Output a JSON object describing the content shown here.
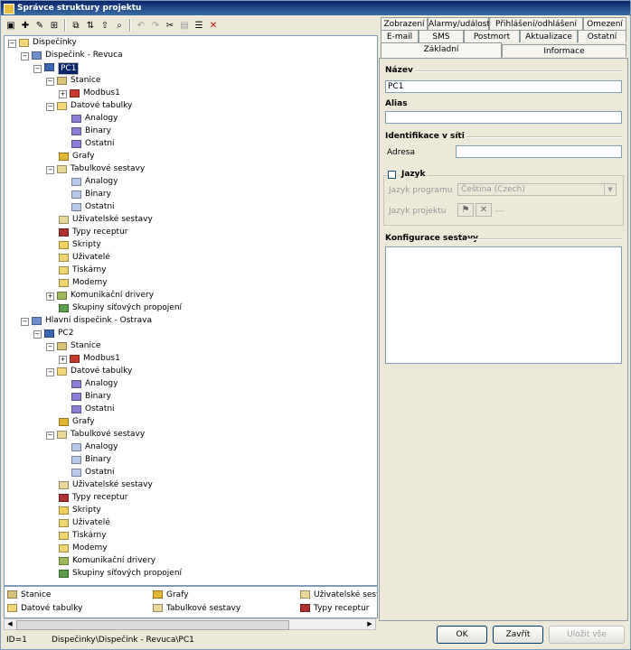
{
  "window": {
    "title": "Správce struktury projektu"
  },
  "tree": {
    "root": "Dispečinky",
    "dispatch1": "Dispečink - Revuca",
    "pc1": "PC1",
    "stanice": "Stanice",
    "modbus": "Modbus1",
    "datove_tabulky": "Datové tabulky",
    "analogy": "Analogy",
    "binary": "Binary",
    "ostatni": "Ostatni",
    "grafy": "Grafy",
    "tabulkove_sestavy": "Tabulkové sestavy",
    "uzivatelske_sestavy": "Uživatelské sestavy",
    "typy_receptur": "Typy receptur",
    "skripty": "Skripty",
    "uzivatele": "Uživatelé",
    "tiskarny": "Tiskárny",
    "modemy": "Modemy",
    "komunikacni_drivery": "Komunikační drivery",
    "skupiny": "Skupiny síťových propojení",
    "dispatch2": "Hlavní dispečink - Ostrava",
    "pc2": "PC2"
  },
  "legend": {
    "stanice": "Stanice",
    "grafy": "Grafy",
    "uzivatelske": "Uživatelské sestav",
    "datove": "Datové tabulky",
    "tabulkove": "Tabulkové sestavy",
    "typy": "Typy receptur"
  },
  "status": {
    "id": "ID=1",
    "path": "Dispečinky\\Dispečink - Revuca\\PC1"
  },
  "tabs": {
    "row1": [
      "Zobrazení",
      "Alarmy/události",
      "Přihlášení/odhlášení",
      "Omezení"
    ],
    "row2": [
      "E-mail",
      "SMS",
      "Postmort",
      "Aktualizace",
      "Ostatní"
    ],
    "row3": [
      "Základní",
      "Informace"
    ]
  },
  "form": {
    "nazev_label": "Název",
    "nazev_value": "PC1",
    "alias_label": "Alias",
    "alias_value": "",
    "ident_label": "Identifikace v síti",
    "adresa_label": "Adresa",
    "adresa_value": "",
    "jazyk_label": "Jazyk",
    "jazyk_programu_label": "Jazyk programu",
    "jazyk_programu_value": "Čeština (Czech)",
    "jazyk_projektu_label": "Jazyk projektu",
    "jazyk_projektu_value": "---",
    "konfigurace_label": "Konfigurace sestavy"
  },
  "buttons": {
    "ok": "OK",
    "zavrit": "Zavřít",
    "ulozit": "Uložit vše"
  },
  "colors": {
    "title_bar": "#0a246a",
    "selection": "#0a246a",
    "background": "#ece9d8"
  }
}
